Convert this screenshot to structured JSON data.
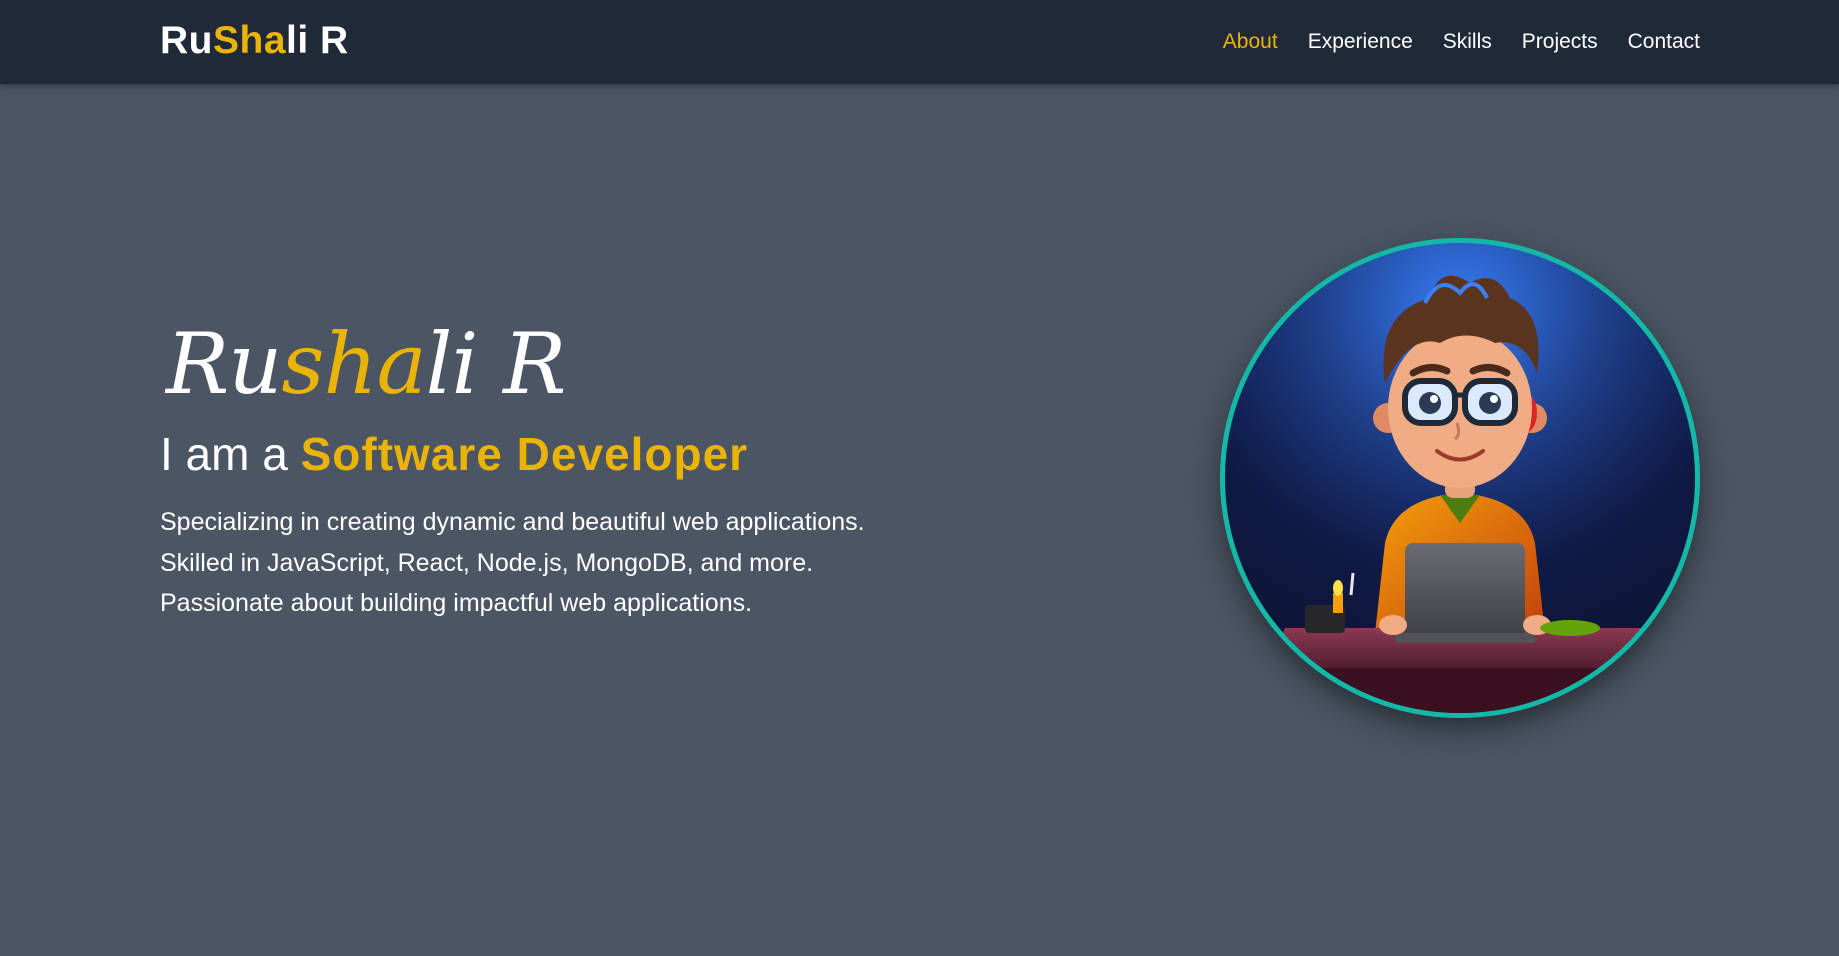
{
  "nav": {
    "brand": {
      "part1": "Ru",
      "part2": "Sha",
      "part3": "li R"
    },
    "links": [
      {
        "label": "About",
        "active": true
      },
      {
        "label": "Experience",
        "active": false
      },
      {
        "label": "Skills",
        "active": false
      },
      {
        "label": "Projects",
        "active": false
      },
      {
        "label": "Contact",
        "active": false
      }
    ]
  },
  "hero": {
    "script_name": {
      "part1": "Ru",
      "part2": "sha",
      "part3": "li R"
    },
    "headline_prefix": "I am a ",
    "headline_role": "Software Developer",
    "description": [
      "Specializing in creating dynamic and beautiful web applications.",
      "Skilled in JavaScript, React, Node.js, MongoDB, and more.",
      "Passionate about building impactful web applications."
    ],
    "avatar": {
      "icon": "developer-avatar-illustration",
      "ring_color": "#14b8a6"
    }
  },
  "colors": {
    "accent": "#eab308",
    "nav_bg": "#1f2937",
    "page_bg": "#4b5563"
  }
}
